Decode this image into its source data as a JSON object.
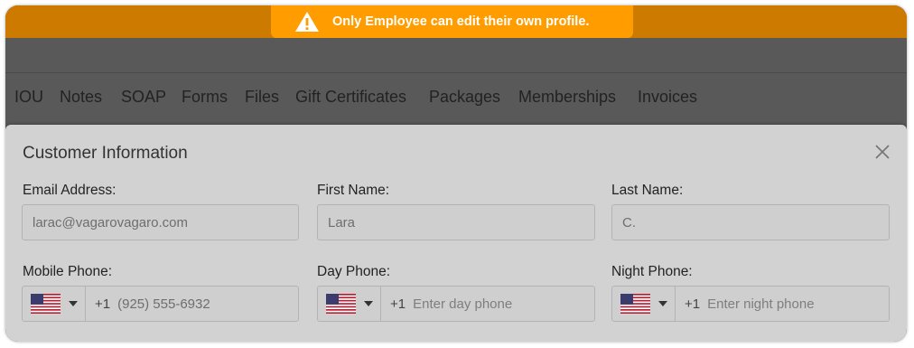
{
  "toast": {
    "message": "Only Employee can edit their own profile.",
    "icon": "warning-icon",
    "color": "#ff9c00"
  },
  "tabs": [
    {
      "label": "IOU"
    },
    {
      "label": "Notes"
    },
    {
      "label": "SOAP"
    },
    {
      "label": "Forms"
    },
    {
      "label": "Files"
    },
    {
      "label": "Gift Certificates"
    },
    {
      "label": "Packages"
    },
    {
      "label": "Memberships"
    },
    {
      "label": "Invoices"
    }
  ],
  "modal": {
    "title": "Customer Information",
    "close_icon": "close-icon"
  },
  "fields": {
    "email": {
      "label": "Email Address:",
      "value": "larac@vagarovagaro.com"
    },
    "first_name": {
      "label": "First Name:",
      "value": "Lara"
    },
    "last_name": {
      "label": "Last Name:",
      "value": "C."
    },
    "mobile": {
      "label": "Mobile Phone:",
      "code": "+1",
      "value": "(925) 555-6932",
      "flag": "us-flag-icon"
    },
    "day": {
      "label": "Day Phone:",
      "code": "+1",
      "placeholder": "Enter day phone",
      "flag": "us-flag-icon"
    },
    "night": {
      "label": "Night Phone:",
      "code": "+1",
      "placeholder": "Enter night phone",
      "flag": "us-flag-icon"
    }
  }
}
